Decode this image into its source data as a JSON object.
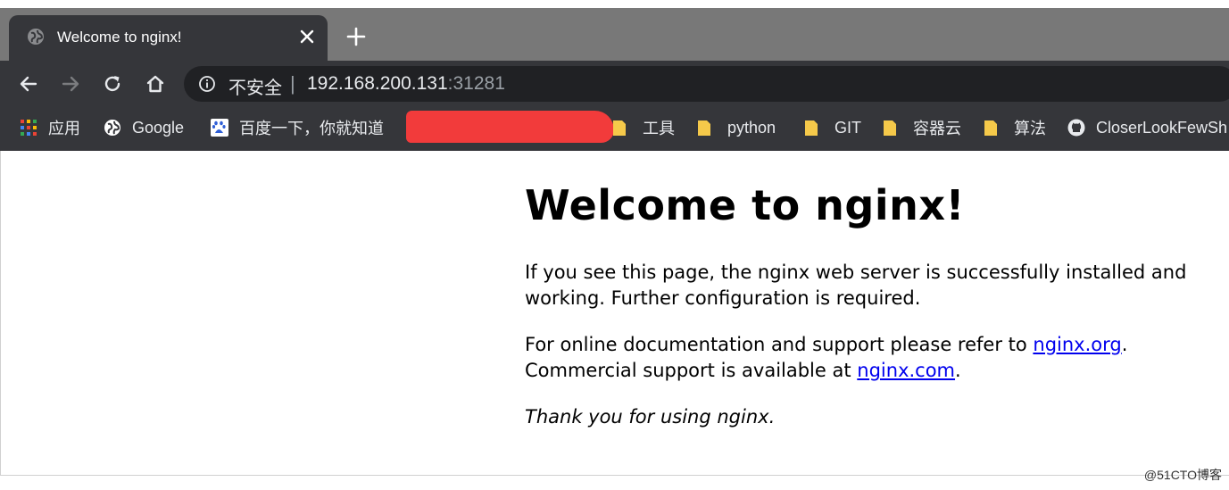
{
  "tab": {
    "title": "Welcome to nginx!",
    "favicon": "globe-icon",
    "close_icon": "close-icon",
    "new_tab_icon": "plus-icon"
  },
  "toolbar": {
    "back_icon": "arrow-left-icon",
    "forward_icon": "arrow-right-icon",
    "reload_icon": "reload-icon",
    "home_icon": "home-icon",
    "security_label": "不安全",
    "separator": "|",
    "url_host": "192.168.200.131",
    "url_port": ":31281"
  },
  "bookmarks": {
    "apps": "应用",
    "google": "Google",
    "baidu": "百度一下，你就知道",
    "tools": "工具",
    "python": "python",
    "git": "GIT",
    "container": "容器云",
    "algorithm": "算法",
    "github": "CloserLookFewSh"
  },
  "page": {
    "heading": "Welcome to nginx!",
    "p1_line1": "If you see this page, the nginx web server is successfully installed and",
    "p1_line2": "working. Further configuration is required.",
    "p2_line1_prefix": "For online documentation and support please refer to ",
    "p2_link1": "nginx.org",
    "p2_line1_suffix": ".",
    "p2_line2_prefix": "Commercial support is available at ",
    "p2_link2": "nginx.com",
    "p2_line2_suffix": ".",
    "p3": "Thank you for using nginx."
  },
  "watermark": "@51CTO博客",
  "colors": {
    "chrome_dark": "#35363a",
    "tabstrip": "#787878",
    "omnibox": "#202124",
    "link": "#0000ee",
    "redaction": "#f23b3b",
    "folder": "#f5c94a"
  }
}
